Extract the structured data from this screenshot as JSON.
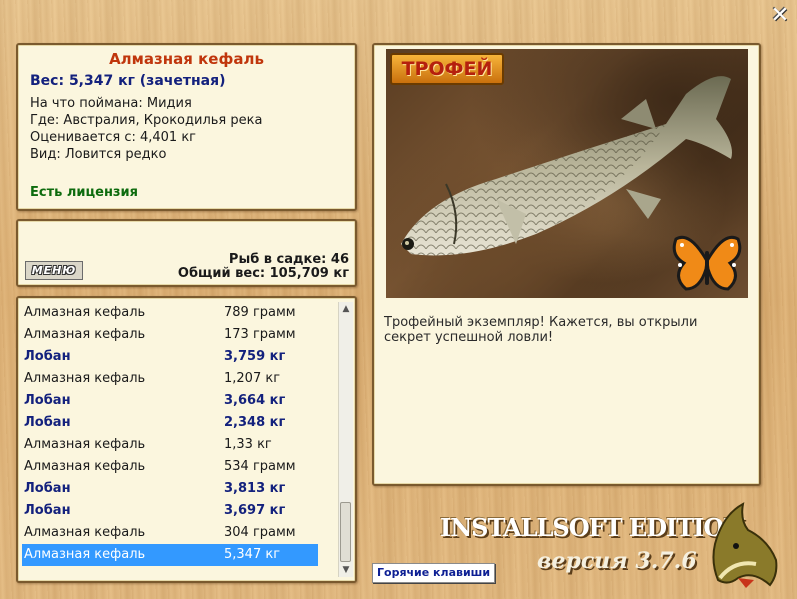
{
  "close_glyph": "✕",
  "info": {
    "title": "Алмазная кефаль",
    "weight": "Вес: 5,347 кг (зачетная)",
    "lines": [
      "На что поймана: Мидия",
      "Где: Австралия, Крокодилья река",
      "Оценивается с: 4,401 кг",
      "Вид: Ловится редко"
    ],
    "license": "Есть лицензия"
  },
  "stats": {
    "menu_label": "МЕНЮ",
    "fish_count": "Рыб в садке: 46",
    "total_weight": "Общий вес: 105,709 кг"
  },
  "catch_list": [
    {
      "name": "Алмазная кефаль",
      "weight": "789 грамм",
      "style": "normal"
    },
    {
      "name": "Алмазная кефаль",
      "weight": "173 грамм",
      "style": "normal"
    },
    {
      "name": "Лобан",
      "weight": "3,759 кг",
      "style": "lob"
    },
    {
      "name": "Алмазная кефаль",
      "weight": "1,207 кг",
      "style": "normal"
    },
    {
      "name": "Лобан",
      "weight": "3,664 кг",
      "style": "lob"
    },
    {
      "name": "Лобан",
      "weight": "2,348 кг",
      "style": "lob"
    },
    {
      "name": "Алмазная кефаль",
      "weight": "1,33 кг",
      "style": "normal"
    },
    {
      "name": "Алмазная кефаль",
      "weight": "534 грамм",
      "style": "normal"
    },
    {
      "name": "Лобан",
      "weight": "3,813 кг",
      "style": "lob"
    },
    {
      "name": "Лобан",
      "weight": "3,697 кг",
      "style": "lob"
    },
    {
      "name": "Алмазная кефаль",
      "weight": "304 грамм",
      "style": "normal"
    },
    {
      "name": "Алмазная кефаль",
      "weight": "5,347 кг",
      "style": "sel"
    }
  ],
  "photo": {
    "badge": "ТРОФЕЙ",
    "description": "Трофейный экземпляр! Кажется, вы открыли секрет успешной ловли!"
  },
  "hotkeys_label": "Горячие клавиши",
  "brand": "INSTALLSOFT EDITION",
  "version": "версия 3.7.6",
  "icons": [
    "close-icon",
    "butterfly-icon",
    "fish-photo",
    "pike-logo",
    "scroll-up-icon",
    "scroll-down-icon"
  ]
}
